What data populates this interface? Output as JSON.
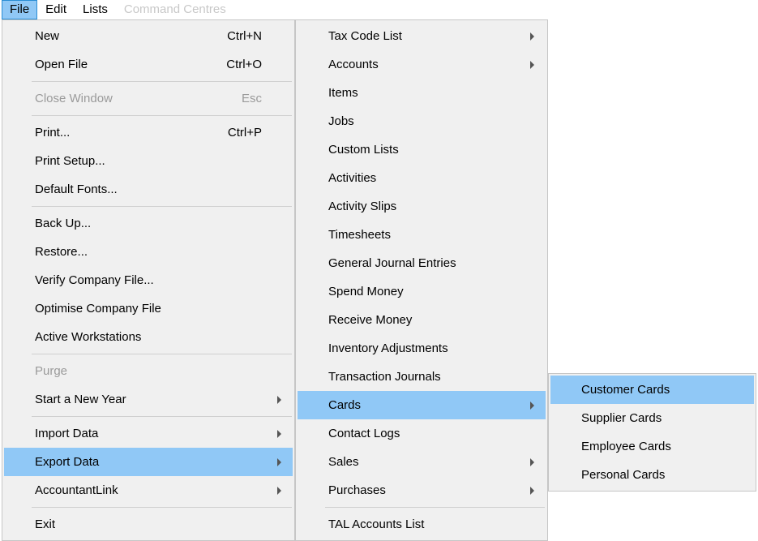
{
  "menubar": {
    "file": "File",
    "edit": "Edit",
    "lists": "Lists",
    "command_centres": "Command Centres"
  },
  "file_menu": {
    "new_label": "New",
    "new_accel": "Ctrl+N",
    "open_label": "Open File",
    "open_accel": "Ctrl+O",
    "close_label": "Close Window",
    "close_accel": "Esc",
    "print_label": "Print...",
    "print_accel": "Ctrl+P",
    "print_setup_label": "Print Setup...",
    "default_fonts_label": "Default Fonts...",
    "backup_label": "Back Up...",
    "restore_label": "Restore...",
    "verify_label": "Verify Company File...",
    "optimise_label": "Optimise Company File",
    "active_ws_label": "Active Workstations",
    "purge_label": "Purge",
    "start_year_label": "Start a New Year",
    "import_label": "Import Data",
    "export_label": "Export Data",
    "accountantlink_label": "AccountantLink",
    "exit_label": "Exit"
  },
  "export_menu": {
    "taxcode_label": "Tax Code List",
    "accounts_label": "Accounts",
    "items_label": "Items",
    "jobs_label": "Jobs",
    "custom_lists_label": "Custom Lists",
    "activities_label": "Activities",
    "activity_slips_label": "Activity Slips",
    "timesheets_label": "Timesheets",
    "gj_label": "General Journal Entries",
    "spend_label": "Spend Money",
    "receive_label": "Receive Money",
    "inv_adj_label": "Inventory Adjustments",
    "txn_journals_label": "Transaction Journals",
    "cards_label": "Cards",
    "contact_logs_label": "Contact Logs",
    "sales_label": "Sales",
    "purchases_label": "Purchases",
    "tal_label": "TAL Accounts List"
  },
  "cards_menu": {
    "customer_label": "Customer Cards",
    "supplier_label": "Supplier Cards",
    "employee_label": "Employee Cards",
    "personal_label": "Personal Cards"
  }
}
